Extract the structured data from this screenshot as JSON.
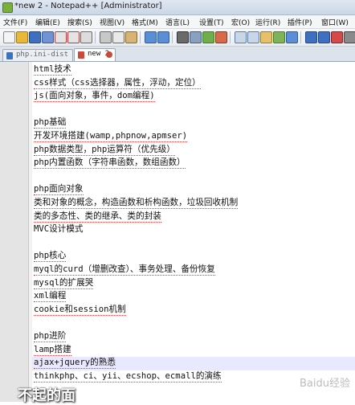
{
  "window": {
    "title": "*new  2 - Notepad++ [Administrator]"
  },
  "menu": [
    "文件(F)",
    "编辑(E)",
    "搜索(S)",
    "视图(V)",
    "格式(M)",
    "语言(L)",
    "设置(T)",
    "宏(O)",
    "运行(R)",
    "插件(P)",
    "窗口(W)"
  ],
  "tabs": [
    {
      "label": "php.ini-dist",
      "active": false
    },
    {
      "label": "new  2",
      "active": true
    }
  ],
  "editor": {
    "current_line": 23,
    "lines": [
      {
        "num": "1",
        "text": "html技术"
      },
      {
        "num": "2",
        "text": "css样式（css选择器，属性，浮动，定位）"
      },
      {
        "num": "3",
        "text": "js(面向对象，事件，dom编程)"
      },
      {
        "num": "4",
        "text": ""
      },
      {
        "num": "5",
        "text": "php基础"
      },
      {
        "num": "6",
        "text": "开发环境搭建(wamp,phpnow,apmser)"
      },
      {
        "num": "7",
        "text": "php数据类型，php运算符（优先级）"
      },
      {
        "num": "8",
        "text": "php内置函数（字符串函数，数组函数）"
      },
      {
        "num": "9",
        "text": ""
      },
      {
        "num": "10",
        "text": "php面向对象"
      },
      {
        "num": "11",
        "text": "类和对象的概念，构造函数和析构函数，垃圾回收机制"
      },
      {
        "num": "12",
        "text": "类的多态性、类的继承、类的封装"
      },
      {
        "num": "13",
        "text": "MVC设计模式"
      },
      {
        "num": "14",
        "text": ""
      },
      {
        "num": "15",
        "text": "php核心"
      },
      {
        "num": "16",
        "text": "myql的curd（增删改查）、事务处理、备份恢复"
      },
      {
        "num": "17",
        "text": "mysql的扩展哭"
      },
      {
        "num": "18",
        "text": "xml编程"
      },
      {
        "num": "19",
        "text": "cookie和session机制"
      },
      {
        "num": "20",
        "text": ""
      },
      {
        "num": "21",
        "text": "php进阶"
      },
      {
        "num": "22",
        "text": "lamp搭建"
      },
      {
        "num": "23",
        "text": "ajax+jquery的熟悉"
      },
      {
        "num": "24",
        "text": "thinkphp、ci、yii、ecshop、ecmall的演练"
      },
      {
        "num": "25",
        "text": ""
      }
    ]
  },
  "watermark": {
    "text": "不起的面",
    "logo": "Baidu经验"
  },
  "colors": {
    "current_line": "#e8e8ff",
    "gutter": "#e4e4e4",
    "spell_underline": "#e03b3b"
  }
}
